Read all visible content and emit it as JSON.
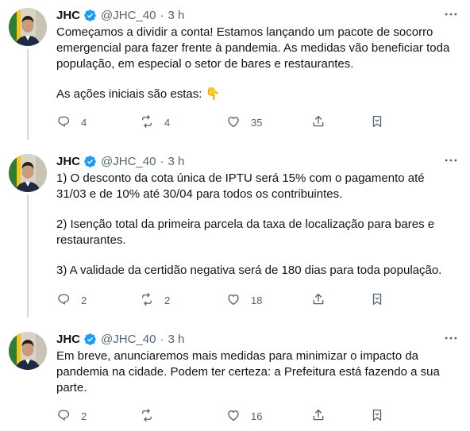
{
  "tweets": [
    {
      "name": "JHC",
      "handle": "@JHC_40",
      "separator": "·",
      "time": "3 h",
      "text": [
        "Começamos a dividir a conta! Estamos lançando um pacote de socorro emergencial para fazer frente à pandemia. As medidas vão beneficiar toda população, em especial o setor de bares e restaurantes.",
        "As ações iniciais são estas: 👇"
      ],
      "replies": "4",
      "retweets": "4",
      "likes": "35"
    },
    {
      "name": "JHC",
      "handle": "@JHC_40",
      "separator": "·",
      "time": "3 h",
      "text": [
        "1) O desconto da cota única de IPTU será 15% com o pagamento até 31/03 e de 10% até 30/04 para todos os contribuintes.",
        "2) Isenção total da primeira parcela da taxa de localização para bares e restaurantes.",
        "3) A validade da certidão negativa será de 180 dias para toda população."
      ],
      "replies": "2",
      "retweets": "2",
      "likes": "18"
    },
    {
      "name": "JHC",
      "handle": "@JHC_40",
      "separator": "·",
      "time": "3 h",
      "text": [
        "Em breve, anunciaremos mais medidas para minimizar o impacto da pandemia na cidade. Podem ter certeza: a Prefeitura está fazendo a sua parte."
      ],
      "replies": "2",
      "retweets": "",
      "likes": "16"
    }
  ],
  "icons": {
    "verified": "verified-badge-icon",
    "more": "more-options-icon",
    "reply": "reply-icon",
    "retweet": "retweet-icon",
    "like": "like-icon",
    "share": "share-icon",
    "bookmark": "bookmark-icon"
  },
  "colors": {
    "verified": "#1d9bf0",
    "text": "#0f1419",
    "secondary": "#536471",
    "thread_line": "#cfd9de",
    "divider": "#eff3f4"
  }
}
